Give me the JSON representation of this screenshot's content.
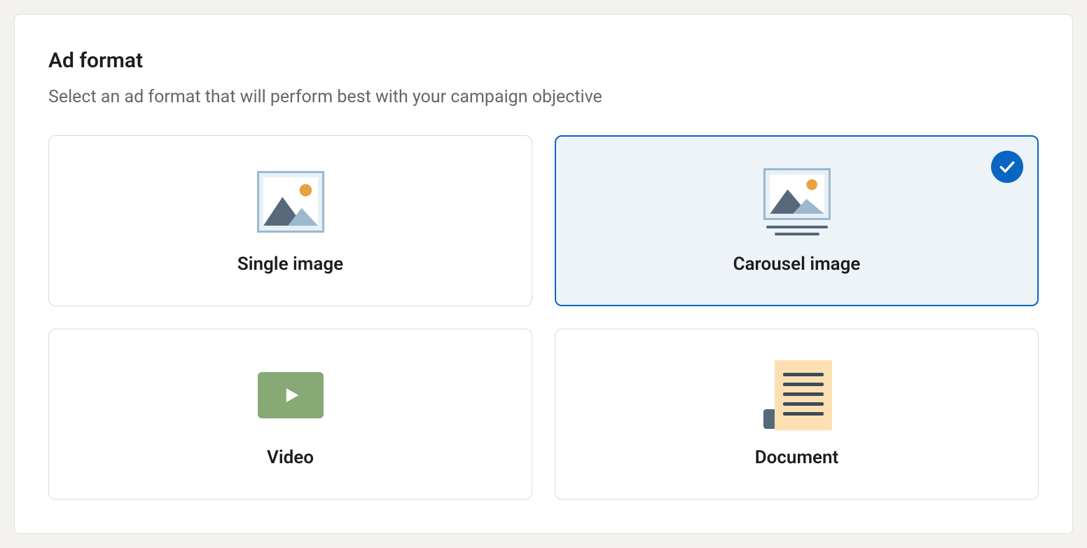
{
  "section": {
    "title": "Ad format",
    "subtitle": "Select an ad format that will perform best with your campaign objective"
  },
  "options": {
    "single_image": {
      "label": "Single image",
      "selected": false
    },
    "carousel_image": {
      "label": "Carousel image",
      "selected": true
    },
    "video": {
      "label": "Video",
      "selected": false
    },
    "document": {
      "label": "Document",
      "selected": false
    }
  }
}
